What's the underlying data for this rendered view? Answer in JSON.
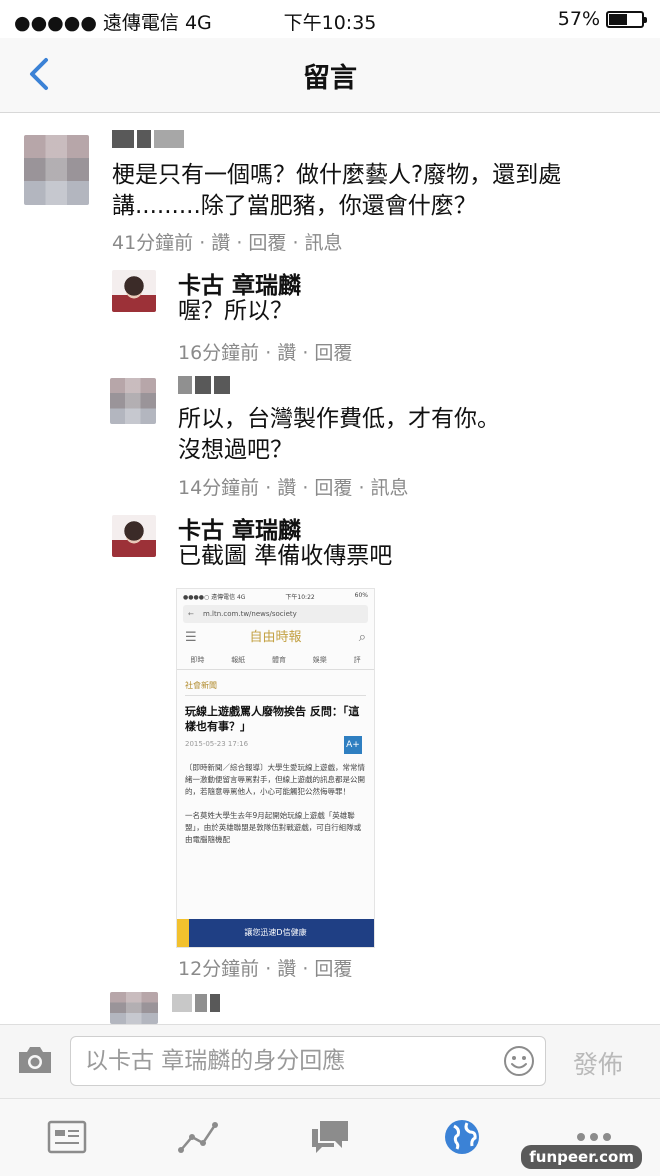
{
  "status": {
    "carrier": "●●●●● 遠傳電信  4G",
    "time": "下午10:35",
    "battery_pct": "57%",
    "battery_level": 0.57
  },
  "nav": {
    "title": "留言"
  },
  "comments": [
    {
      "text": "梗是只有一個嗎？做什麼藝人?廢物，還到處講.........除了當肥豬，你還會什麼？",
      "meta": "41分鐘前 · 讚 · 回覆 · 訊息"
    },
    {
      "name": "卡古 章瑞麟",
      "text": "喔？所以？",
      "meta": "16分鐘前 · 讚 · 回覆"
    },
    {
      "text": "所以，台灣製作費低，才有你。\n沒想過吧？",
      "meta": "14分鐘前 · 讚 · 回覆 · 訊息"
    },
    {
      "name": "卡古 章瑞麟",
      "text": "已截圖 準備收傳票吧",
      "meta": "12分鐘前 · 讚 · 回覆"
    }
  ],
  "screenshot": {
    "status_left": "●●●●○ 遠傳電信 4G",
    "status_time": "下午10:22",
    "status_right": "60%",
    "url": "m.ltn.com.tw/news/society",
    "logo": "自由時報",
    "menu": [
      "即時",
      "報紙",
      "體育",
      "娛樂",
      "評"
    ],
    "section": "社會新聞",
    "headline": "玩線上遊戲罵人廢物挨告 反問：「這樣也有事？」",
    "date": "2015-05-23 17:16",
    "font_btn": "A+",
    "body": "〔即時新聞／綜合報導〕大學生愛玩線上遊戲，常常情緒一激動便留言辱罵對手，但線上遊戲的訊息都是公開的，若隨意辱罵他人，小心可能觸犯公然侮辱罪！\n\n一名莫姓大學生去年9月起開始玩線上遊戲「英雄聯盟」，由於英雄聯盟是敦隊伍對戰遊戲，可自行組隊或由電腦隨機配",
    "ad": "讓您迅速D信健康"
  },
  "input": {
    "placeholder": "以卡古 章瑞麟的身分回應",
    "send_label": "發佈"
  },
  "tabs": [
    "news-feed-icon",
    "activity-icon",
    "messages-icon",
    "globe-icon",
    "more-icon"
  ],
  "watermark": "funpeer.com",
  "colors": {
    "accent": "#3b82d6",
    "meta": "#8a8a8a",
    "send_disabled": "#b9b9b9"
  }
}
